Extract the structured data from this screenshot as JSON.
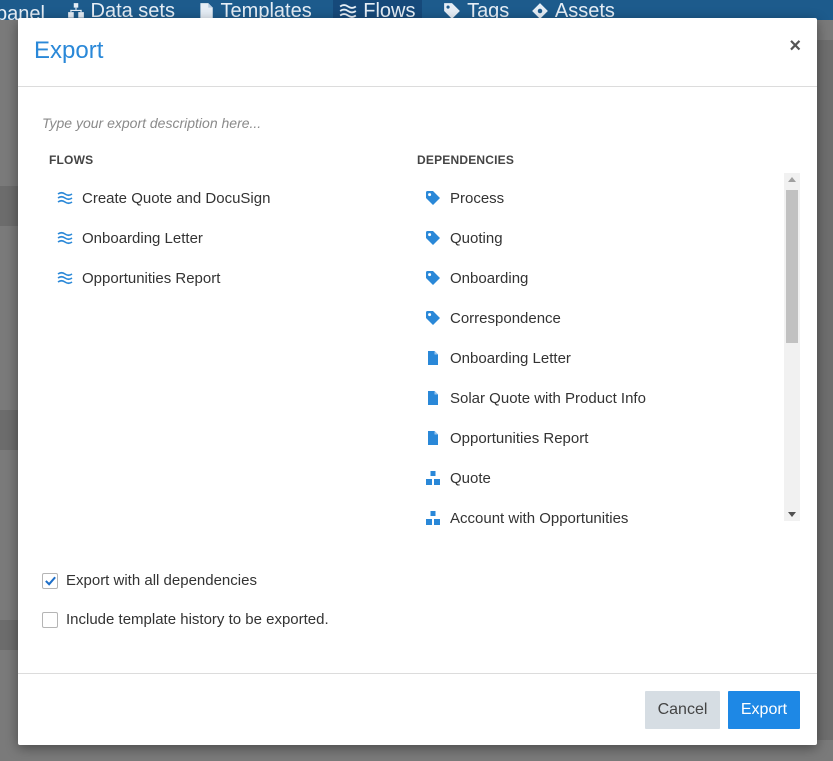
{
  "background_nav": {
    "items": [
      {
        "label": "panel",
        "icon": "none"
      },
      {
        "label": "Data sets",
        "icon": "sitemap-icon"
      },
      {
        "label": "Templates",
        "icon": "file-icon"
      },
      {
        "label": "Flows",
        "icon": "flows-icon"
      },
      {
        "label": "Tags",
        "icon": "tag-icon"
      },
      {
        "label": "Assets",
        "icon": "diamond-icon"
      }
    ]
  },
  "modal": {
    "title": "Export",
    "close_label": "×",
    "description_placeholder": "Type your export description here...",
    "flows": {
      "heading": "FLOWS",
      "items": [
        {
          "label": "Create Quote and DocuSign",
          "icon": "flows-icon"
        },
        {
          "label": "Onboarding Letter",
          "icon": "flows-icon"
        },
        {
          "label": "Opportunities Report",
          "icon": "flows-icon"
        }
      ]
    },
    "dependencies": {
      "heading": "DEPENDENCIES",
      "items": [
        {
          "label": "Process",
          "icon": "tag-icon"
        },
        {
          "label": "Quoting",
          "icon": "tag-icon"
        },
        {
          "label": "Onboarding",
          "icon": "tag-icon"
        },
        {
          "label": "Correspondence",
          "icon": "tag-icon"
        },
        {
          "label": "Onboarding Letter",
          "icon": "file-icon"
        },
        {
          "label": "Solar Quote with Product Info",
          "icon": "file-icon"
        },
        {
          "label": "Opportunities Report",
          "icon": "file-icon"
        },
        {
          "label": "Quote",
          "icon": "sitemap-icon"
        },
        {
          "label": "Account with Opportunities",
          "icon": "sitemap-icon"
        }
      ]
    },
    "options": {
      "export_all_dependencies": {
        "label": "Export with all dependencies",
        "checked": true
      },
      "include_template_history": {
        "label": "Include template history to be exported.",
        "checked": false
      }
    },
    "footer": {
      "cancel_label": "Cancel",
      "export_label": "Export"
    }
  },
  "colors": {
    "accent": "#1e88e5",
    "title": "#2a88d8",
    "icon": "#2a88d8",
    "cancel_bg": "#d6dde3"
  }
}
